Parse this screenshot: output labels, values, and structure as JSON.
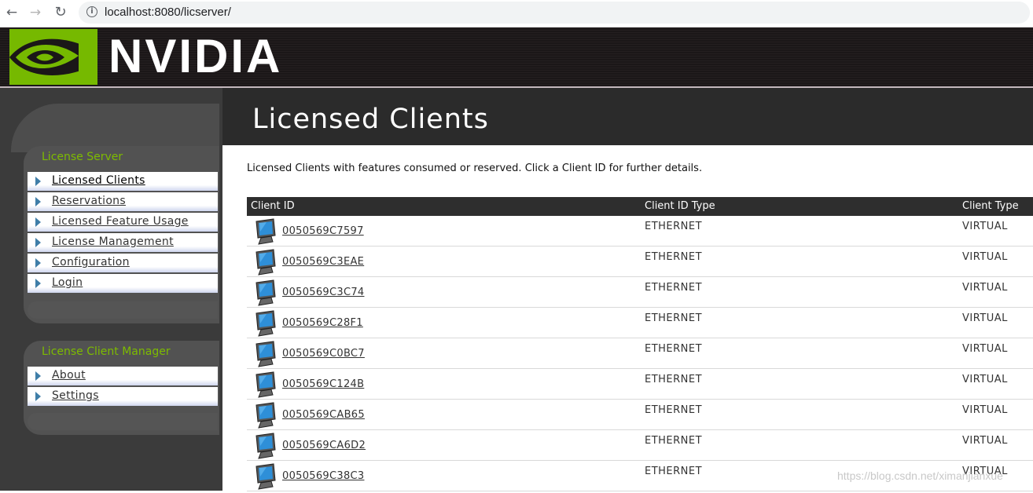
{
  "browser": {
    "back_icon": "arrow-left-icon",
    "forward_icon": "arrow-right-icon",
    "reload_icon": "reload-icon",
    "url": "localhost:8080/licserver/"
  },
  "brand": {
    "logo_text": "NVIDIA",
    "logo_color": "#76b900"
  },
  "sidebar": {
    "license_server": {
      "title": "License Server",
      "items": [
        {
          "label": "Licensed Clients"
        },
        {
          "label": "Reservations"
        },
        {
          "label": "Licensed Feature Usage"
        },
        {
          "label": "License Management"
        },
        {
          "label": "Configuration"
        },
        {
          "label": "Login"
        }
      ]
    },
    "license_client_manager": {
      "title": "License Client Manager",
      "items": [
        {
          "label": "About"
        },
        {
          "label": "Settings"
        }
      ]
    }
  },
  "main": {
    "title": "Licensed Clients",
    "intro": "Licensed Clients with features consumed or reserved. Click a Client ID for further details.",
    "table": {
      "headers": [
        "Client ID",
        "Client ID Type",
        "Client Type"
      ],
      "rows": [
        {
          "client_id": "0050569C7597",
          "id_type": "ETHERNET",
          "client_type": "VIRTUAL"
        },
        {
          "client_id": "0050569C3EAE",
          "id_type": "ETHERNET",
          "client_type": "VIRTUAL"
        },
        {
          "client_id": "0050569C3C74",
          "id_type": "ETHERNET",
          "client_type": "VIRTUAL"
        },
        {
          "client_id": "0050569C28F1",
          "id_type": "ETHERNET",
          "client_type": "VIRTUAL"
        },
        {
          "client_id": "0050569C0BC7",
          "id_type": "ETHERNET",
          "client_type": "VIRTUAL"
        },
        {
          "client_id": "0050569C124B",
          "id_type": "ETHERNET",
          "client_type": "VIRTUAL"
        },
        {
          "client_id": "0050569CAB65",
          "id_type": "ETHERNET",
          "client_type": "VIRTUAL"
        },
        {
          "client_id": "0050569CA6D2",
          "id_type": "ETHERNET",
          "client_type": "VIRTUAL"
        },
        {
          "client_id": "0050569C38C3",
          "id_type": "ETHERNET",
          "client_type": "VIRTUAL"
        }
      ]
    }
  },
  "watermark": "https://blog.csdn.net/ximanjianxue"
}
